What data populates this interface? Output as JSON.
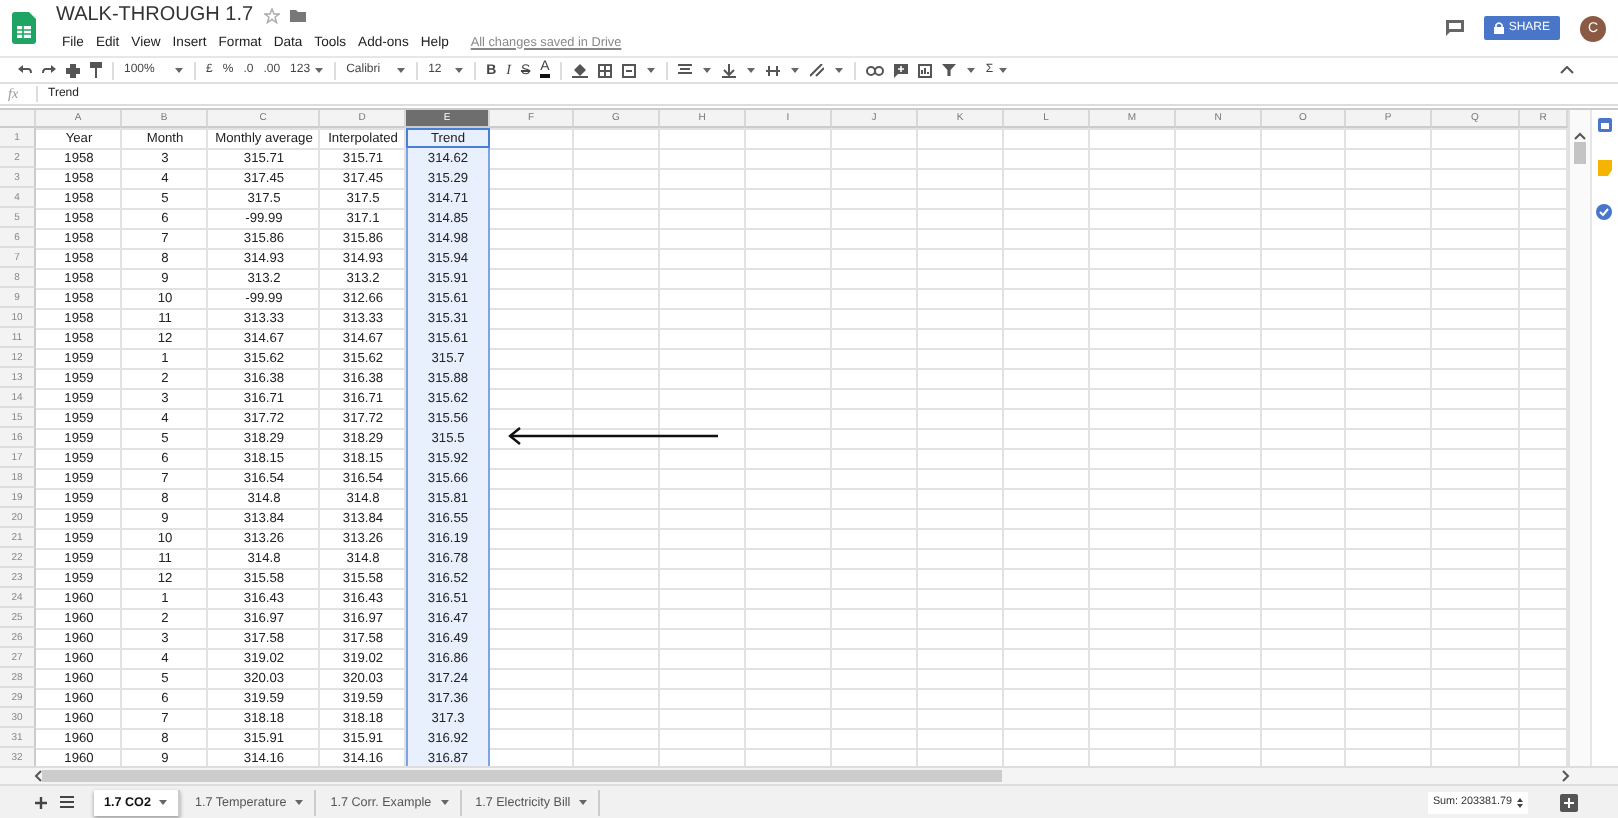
{
  "app": {
    "title": "WALK-THROUGH 1.7",
    "menu": [
      "File",
      "Edit",
      "View",
      "Insert",
      "Format",
      "Data",
      "Tools",
      "Add-ons",
      "Help"
    ],
    "save_status": "All changes saved in Drive",
    "share_button": "SHARE",
    "avatar": "C"
  },
  "toolbar": {
    "zoom": "100%",
    "currency": "£",
    "percent": "%",
    "decimal_less": ".0",
    "decimal_more": ".00",
    "number_format": "123",
    "font": "Calibri",
    "font_size": "12",
    "bold": "B",
    "italic": "I",
    "strikethrough": "S",
    "text_color": "A",
    "functions": "Σ"
  },
  "formula_bar": {
    "label": "fx",
    "value": "Trend"
  },
  "sheet": {
    "columns": [
      {
        "label": "A",
        "selected": false
      },
      {
        "label": "B",
        "selected": false
      },
      {
        "label": "C",
        "selected": false
      },
      {
        "label": "D",
        "selected": false
      },
      {
        "label": "E",
        "selected": true
      },
      {
        "label": "F",
        "selected": false
      },
      {
        "label": "G",
        "selected": false
      },
      {
        "label": "H",
        "selected": false
      },
      {
        "label": "I",
        "selected": false
      },
      {
        "label": "J",
        "selected": false
      },
      {
        "label": "K",
        "selected": false
      },
      {
        "label": "L",
        "selected": false
      },
      {
        "label": "M",
        "selected": false
      },
      {
        "label": "N",
        "selected": false
      },
      {
        "label": "O",
        "selected": false
      },
      {
        "label": "P",
        "selected": false
      },
      {
        "label": "Q",
        "selected": false
      },
      {
        "label": "R",
        "selected": false
      }
    ],
    "rows": [
      {
        "number": "1",
        "cells": [
          "Year",
          "Month",
          "Monthly average",
          "Interpolated",
          "Trend"
        ]
      },
      {
        "number": "2",
        "cells": [
          "1958",
          "3",
          "315.71",
          "315.71",
          "314.62"
        ]
      },
      {
        "number": "3",
        "cells": [
          "1958",
          "4",
          "317.45",
          "317.45",
          "315.29"
        ]
      },
      {
        "number": "4",
        "cells": [
          "1958",
          "5",
          "317.5",
          "317.5",
          "314.71"
        ]
      },
      {
        "number": "5",
        "cells": [
          "1958",
          "6",
          "-99.99",
          "317.1",
          "314.85"
        ]
      },
      {
        "number": "6",
        "cells": [
          "1958",
          "7",
          "315.86",
          "315.86",
          "314.98"
        ]
      },
      {
        "number": "7",
        "cells": [
          "1958",
          "8",
          "314.93",
          "314.93",
          "315.94"
        ]
      },
      {
        "number": "8",
        "cells": [
          "1958",
          "9",
          "313.2",
          "313.2",
          "315.91"
        ]
      },
      {
        "number": "9",
        "cells": [
          "1958",
          "10",
          "-99.99",
          "312.66",
          "315.61"
        ]
      },
      {
        "number": "10",
        "cells": [
          "1958",
          "11",
          "313.33",
          "313.33",
          "315.31"
        ]
      },
      {
        "number": "11",
        "cells": [
          "1958",
          "12",
          "314.67",
          "314.67",
          "315.61"
        ]
      },
      {
        "number": "12",
        "cells": [
          "1959",
          "1",
          "315.62",
          "315.62",
          "315.7"
        ]
      },
      {
        "number": "13",
        "cells": [
          "1959",
          "2",
          "316.38",
          "316.38",
          "315.88"
        ]
      },
      {
        "number": "14",
        "cells": [
          "1959",
          "3",
          "316.71",
          "316.71",
          "315.62"
        ]
      },
      {
        "number": "15",
        "cells": [
          "1959",
          "4",
          "317.72",
          "317.72",
          "315.56"
        ]
      },
      {
        "number": "16",
        "cells": [
          "1959",
          "5",
          "318.29",
          "318.29",
          "315.5"
        ]
      },
      {
        "number": "17",
        "cells": [
          "1959",
          "6",
          "318.15",
          "318.15",
          "315.92"
        ]
      },
      {
        "number": "18",
        "cells": [
          "1959",
          "7",
          "316.54",
          "316.54",
          "315.66"
        ]
      },
      {
        "number": "19",
        "cells": [
          "1959",
          "8",
          "314.8",
          "314.8",
          "315.81"
        ]
      },
      {
        "number": "20",
        "cells": [
          "1959",
          "9",
          "313.84",
          "313.84",
          "316.55"
        ]
      },
      {
        "number": "21",
        "cells": [
          "1959",
          "10",
          "313.26",
          "313.26",
          "316.19"
        ]
      },
      {
        "number": "22",
        "cells": [
          "1959",
          "11",
          "314.8",
          "314.8",
          "316.78"
        ]
      },
      {
        "number": "23",
        "cells": [
          "1959",
          "12",
          "315.58",
          "315.58",
          "316.52"
        ]
      },
      {
        "number": "24",
        "cells": [
          "1960",
          "1",
          "316.43",
          "316.43",
          "316.51"
        ]
      },
      {
        "number": "25",
        "cells": [
          "1960",
          "2",
          "316.97",
          "316.97",
          "316.47"
        ]
      },
      {
        "number": "26",
        "cells": [
          "1960",
          "3",
          "317.58",
          "317.58",
          "316.49"
        ]
      },
      {
        "number": "27",
        "cells": [
          "1960",
          "4",
          "319.02",
          "319.02",
          "316.86"
        ]
      },
      {
        "number": "28",
        "cells": [
          "1960",
          "5",
          "320.03",
          "320.03",
          "317.24"
        ]
      },
      {
        "number": "29",
        "cells": [
          "1960",
          "6",
          "319.59",
          "319.59",
          "317.36"
        ]
      },
      {
        "number": "30",
        "cells": [
          "1960",
          "7",
          "318.18",
          "318.18",
          "317.3"
        ]
      },
      {
        "number": "31",
        "cells": [
          "1960",
          "8",
          "315.91",
          "315.91",
          "316.92"
        ]
      },
      {
        "number": "32",
        "cells": [
          "1960",
          "9",
          "314.16",
          "314.16",
          "316.87"
        ]
      }
    ]
  },
  "tabs": [
    {
      "label": "1.7 CO2",
      "selected": true
    },
    {
      "label": "1.7 Temperature",
      "selected": false
    },
    {
      "label": "1.7 Corr. Example",
      "selected": false
    },
    {
      "label": "1.7 Electricity Bill",
      "selected": false
    }
  ],
  "status": {
    "sum": "Sum: 203381.79"
  }
}
